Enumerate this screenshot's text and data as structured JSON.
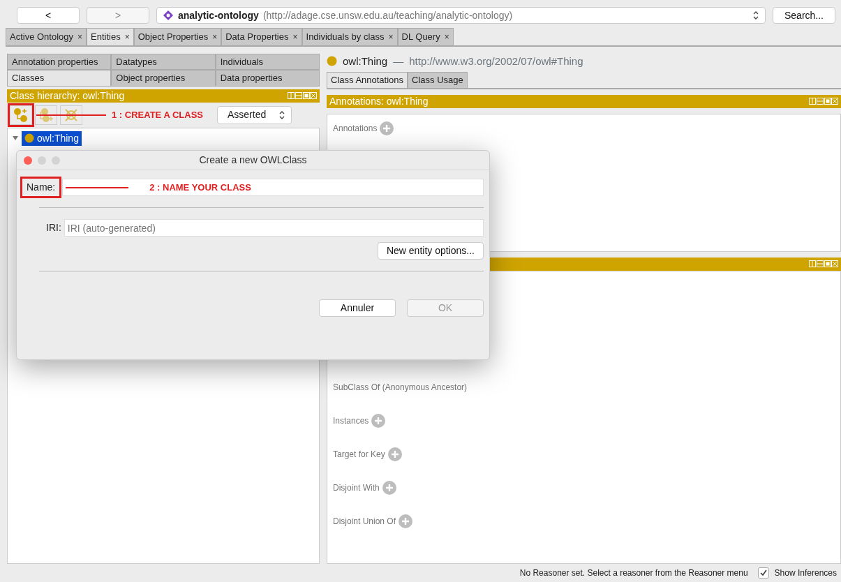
{
  "nav_buttons": [
    {
      "label": "<",
      "disabled": false
    },
    {
      "label": ">",
      "disabled": true
    }
  ],
  "ontology": {
    "name": "analytic-ontology",
    "iri": "(http://adage.cse.unsw.edu.au/teaching/analytic-ontology)"
  },
  "search_button": "Search...",
  "workspace_tabs": [
    {
      "label": "Active Ontology",
      "close": "×",
      "selected": false
    },
    {
      "label": "Entities",
      "close": "×",
      "selected": true
    },
    {
      "label": "Object Properties",
      "close": "×",
      "selected": false
    },
    {
      "label": "Data Properties",
      "close": "×",
      "selected": false
    },
    {
      "label": "Individuals by class",
      "close": "×",
      "selected": false
    },
    {
      "label": "DL Query",
      "close": "×",
      "selected": false
    }
  ],
  "entity_tab_rows": [
    {
      "tabs": [
        {
          "label": "Annotation properties",
          "selected": false
        },
        {
          "label": "Datatypes",
          "selected": false
        },
        {
          "label": "Individuals",
          "selected": false
        }
      ]
    },
    {
      "tabs": [
        {
          "label": "Classes",
          "selected": true
        },
        {
          "label": "Object properties",
          "selected": false
        },
        {
          "label": "Data properties",
          "selected": false
        }
      ]
    }
  ],
  "class_hierarchy": {
    "title": "Class hierarchy: owl:Thing",
    "annotation": "1 : CREATE A CLASS",
    "view_mode": "Asserted",
    "tree": [
      {
        "label": "owl:Thing",
        "selected": true,
        "expanded": true
      }
    ]
  },
  "entity_header": {
    "name": "owl:Thing",
    "separator": "—",
    "iri": "http://www.w3.org/2002/07/owl#Thing"
  },
  "class_tabs": [
    {
      "label": "Class Annotations",
      "selected": true
    },
    {
      "label": "Class Usage",
      "selected": false
    }
  ],
  "annotations_view": {
    "title": "Annotations: owl:Thing",
    "sections": [
      {
        "label": "Annotations",
        "addable": true
      }
    ]
  },
  "usage_view": {
    "sections": [
      {
        "label": "SubClass Of (Anonymous Ancestor)",
        "addable": false
      },
      {
        "label": "Instances",
        "addable": true
      },
      {
        "label": "Target for Key",
        "addable": true
      },
      {
        "label": "Disjoint With",
        "addable": true
      },
      {
        "label": "Disjoint Union Of",
        "addable": true
      }
    ]
  },
  "status_bar": {
    "message": "No Reasoner set. Select a reasoner from the Reasoner menu",
    "show_inferences": {
      "label": "Show Inferences",
      "checked": true
    }
  },
  "dialog": {
    "title": "Create a new OWLClass",
    "name_label": "Name:",
    "name_annotation": "2 : NAME YOUR CLASS",
    "iri_label": "IRI:",
    "iri_placeholder": "IRI (auto-generated)",
    "options_button": "New entity options...",
    "buttons": [
      {
        "label": "Annuler",
        "disabled": false
      },
      {
        "label": "OK",
        "disabled": true
      }
    ]
  }
}
